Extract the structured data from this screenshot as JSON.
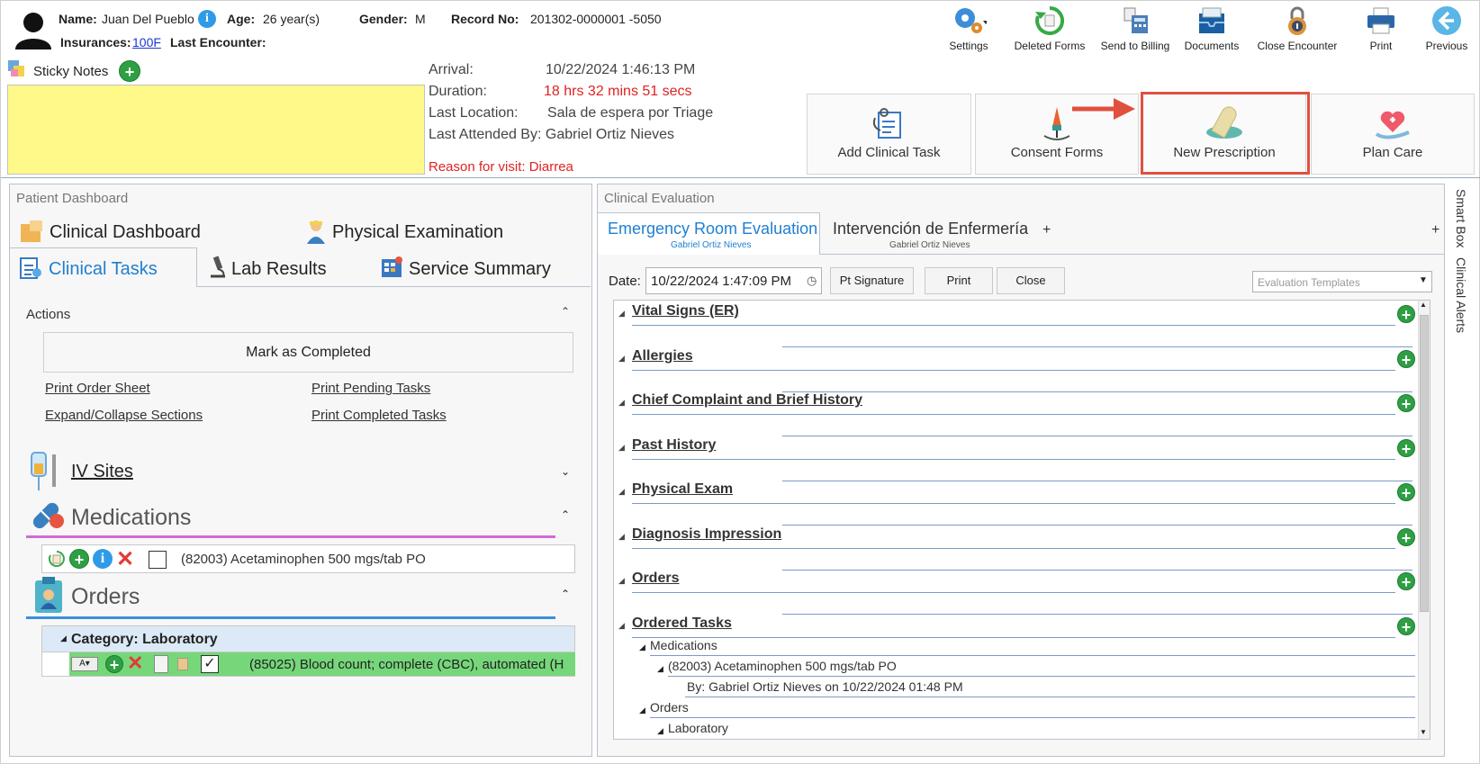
{
  "patient": {
    "name_label": "Name:",
    "name": "Juan Del Pueblo",
    "age_label": "Age:",
    "age": "26 year(s)",
    "gender_label": "Gender:",
    "gender": "M",
    "record_label": "Record No:",
    "record": "201302-0000001 -5050",
    "insurances_label": "Insurances:",
    "insurance": "100F",
    "last_encounter_label": "Last Encounter:"
  },
  "toolbar": {
    "settings": "Settings",
    "deleted_forms": "Deleted Forms",
    "send_to_billing": "Send to Billing",
    "documents": "Documents",
    "close_encounter": "Close Encounter",
    "print": "Print",
    "previous": "Previous"
  },
  "sticky_notes": {
    "label": "Sticky Notes"
  },
  "visit": {
    "arrival_label": "Arrival:",
    "arrival": "10/22/2024 1:46:13 PM",
    "duration_label": "Duration:",
    "duration": "18 hrs 32 mins 51 secs",
    "last_location_label": "Last Location:",
    "last_location": "Sala de espera por Triage",
    "last_attended": "Last Attended By: Gabriel Ortiz Nieves",
    "reason": "Reason for visit: Diarrea"
  },
  "actions": {
    "add_clinical_task": "Add Clinical Task",
    "consent_forms": "Consent Forms",
    "new_prescription": "New Prescription",
    "plan_care": "Plan Care"
  },
  "dashboard": {
    "title": "Patient Dashboard",
    "tabs": {
      "clinical_dashboard": "Clinical Dashboard",
      "physical_examination": "Physical Examination",
      "clinical_tasks": "Clinical Tasks",
      "lab_results": "Lab Results",
      "service_summary": "Service Summary"
    },
    "actions_label": "Actions",
    "mark_completed": "Mark as Completed",
    "print_order_sheet": "Print Order Sheet",
    "print_pending_tasks": "Print Pending Tasks",
    "expand_collapse": "Expand/Collapse Sections",
    "print_completed_tasks": "Print Completed Tasks",
    "iv_sites": "IV Sites",
    "medications": "Medications",
    "medication_item": "(82003) Acetaminophen 500 mgs/tab PO",
    "orders": "Orders",
    "category": "Category: Laboratory",
    "order_item": "(85025) Blood count; complete (CBC), automated (H"
  },
  "evaluation": {
    "title": "Clinical Evaluation",
    "tab1": "Emergency Room Evaluation",
    "tab1_sub": "Gabriel Ortiz Nieves",
    "tab2": "Intervención de Enfermería",
    "tab2_sub": "Gabriel Ortiz Nieves",
    "add_tab": "+",
    "date_label": "Date:",
    "date": "10/22/2024 1:47:09 PM",
    "pt_signature": "Pt Signature",
    "print": "Print",
    "close": "Close",
    "templates_placeholder": "Evaluation Templates",
    "sections": {
      "s1": "Vital Signs (ER)",
      "s2": "Allergies",
      "s3": "Chief Complaint and Brief History",
      "s4": "Past History",
      "s5": "Physical Exam",
      "s6": "Diagnosis Impression",
      "s7": "Orders",
      "s8": "Ordered Tasks"
    },
    "tree": {
      "medications": "Medications",
      "med_item": "(82003) Acetaminophen 500 mgs/tab PO",
      "by": "By: Gabriel Ortiz Nieves on 10/22/2024 01:48 PM",
      "orders": "Orders",
      "laboratory": "Laboratory"
    }
  },
  "side": {
    "smart_box": "Smart Box",
    "clinical_alerts": "Clinical Alerts"
  },
  "colors": {
    "accent": "#1f7fd0",
    "highlight": "#e0503f",
    "sticky": "#fff98a",
    "order_row": "#76d77a"
  }
}
